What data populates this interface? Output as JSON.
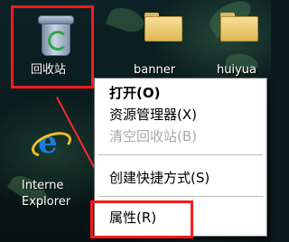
{
  "desktop": {
    "recycle_bin_label": "回收站",
    "folder_label_1": "banner",
    "folder_label_2": "huiyua",
    "ie_label_line1": "Interne",
    "ie_label_line2": "Explorer"
  },
  "context_menu": {
    "items": [
      {
        "label": "打开(O)",
        "style": "bold"
      },
      {
        "label": "资源管理器(X)",
        "style": "normal"
      },
      {
        "label": "清空回收站(B)",
        "style": "disabled"
      },
      {
        "label": "创建快捷方式(S)",
        "style": "normal"
      },
      {
        "label": "属性(R)",
        "style": "normal"
      }
    ]
  },
  "annotation_color": "#ff1a1a"
}
